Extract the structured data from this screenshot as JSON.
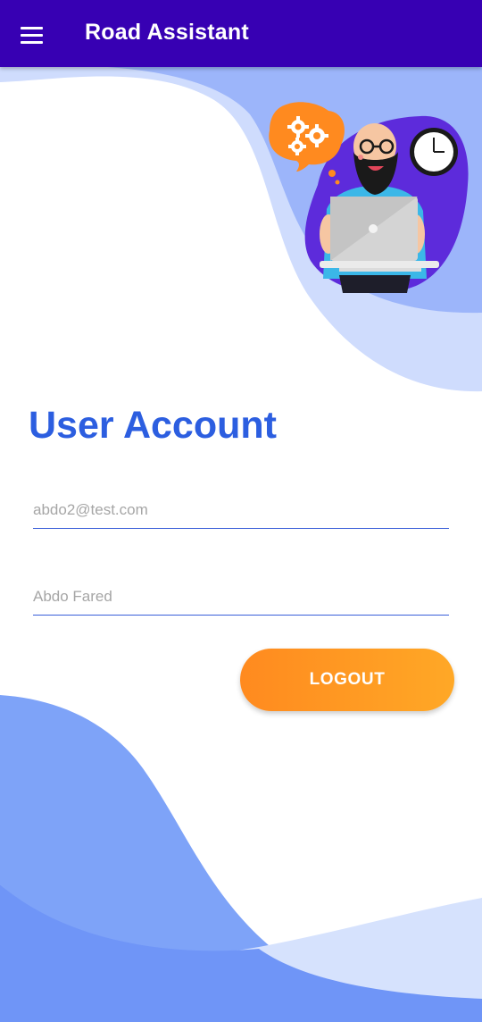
{
  "appbar": {
    "title": "Road Assistant",
    "menu_icon": "hamburger-menu-icon",
    "background": "#3700b3"
  },
  "page": {
    "title": "User Account",
    "title_color": "#2c5ee0"
  },
  "form": {
    "email_placeholder": "abdo2@test.com",
    "name_placeholder": "Abdo Fared"
  },
  "actions": {
    "logout_label": "LOGOUT",
    "logout_gradient": [
      "#ff8a1f",
      "#ffa826"
    ]
  },
  "illustration": {
    "subject": "man-with-laptop-illustration",
    "icons": [
      "gears-icon",
      "clock-icon"
    ]
  },
  "colors": {
    "wave_dark": "#6f95f7",
    "wave_mid": "#9cb5fa",
    "wave_light": "#cfdcfd",
    "blob_purple": "#5d2bdb"
  }
}
